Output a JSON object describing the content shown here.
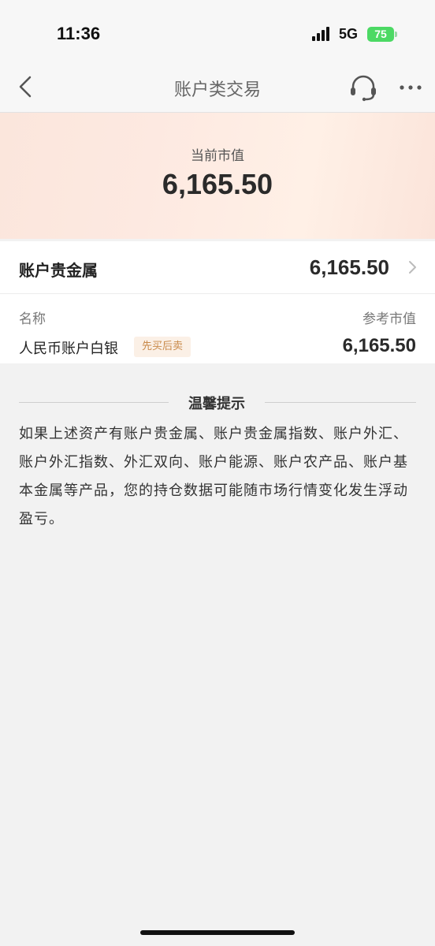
{
  "status_bar": {
    "time": "11:36",
    "network": "5G",
    "battery": "75"
  },
  "nav": {
    "title": "账户类交易",
    "back_icon": "chevron-left-icon",
    "service_icon": "headset-icon",
    "more_icon": "more-dots-icon"
  },
  "summary": {
    "label": "当前市值",
    "value": "6,165.50"
  },
  "section": {
    "title": "账户贵金属",
    "value": "6,165.50",
    "columns": {
      "name": "名称",
      "value": "参考市值"
    },
    "items": [
      {
        "name": "人民币账户白银",
        "badge": "先买后卖",
        "value": "6,165.50"
      }
    ]
  },
  "tips": {
    "title": "温馨提示",
    "body": "如果上述资产有账户贵金属、账户贵金属指数、账户外汇、账户外汇指数、外汇双向、账户能源、账户农产品、账户基本金属等产品，您的持仓数据可能随市场行情变化发生浮动盈亏。"
  },
  "colors": {
    "accent_badge_bg": "#fbf0e6",
    "accent_badge_text": "#c98a4a",
    "battery": "#4cd964"
  }
}
